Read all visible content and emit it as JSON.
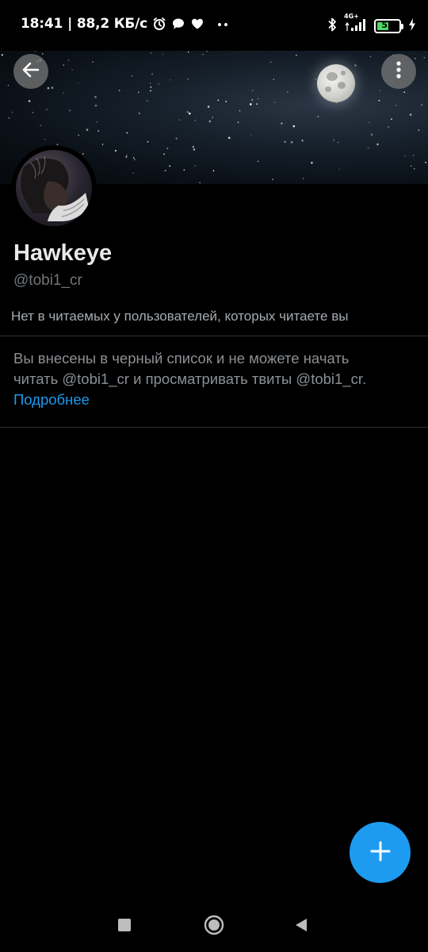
{
  "status_bar": {
    "time": "18:41",
    "network_speed": "| 88,2 КБ/с",
    "battery_level": "52",
    "battery_fraction": 0.52,
    "network_type": "4G+",
    "icons": [
      "alarm-icon",
      "chat-bubble-icon",
      "heart-icon",
      "more-dots-icon",
      "bluetooth-icon",
      "signal-icon",
      "battery-icon",
      "charging-icon"
    ]
  },
  "header": {
    "back_icon": "arrow-left-icon",
    "more_icon": "more-vertical-icon"
  },
  "profile": {
    "display_name": "Hawkeye",
    "handle": "@tobi1_cr",
    "follow_info": "Нет в читаемых у пользователей, которых читаете вы"
  },
  "blocked_notice": {
    "line1": "Вы внесены в черный список и не можете начать",
    "line2": "читать @tobi1_cr и просматривать твиты @tobi1_cr.",
    "learn_more": "Подробнее"
  },
  "fab": {
    "icon": "plus-icon"
  },
  "nav_bar": {
    "icons": [
      "recents-square-icon",
      "home-circle-icon",
      "back-triangle-icon"
    ]
  },
  "colors": {
    "background": "#000000",
    "accent": "#1d9bf0",
    "primary_text": "#e7e9ea",
    "secondary_text": "#71767b",
    "divider": "#2f3336"
  }
}
